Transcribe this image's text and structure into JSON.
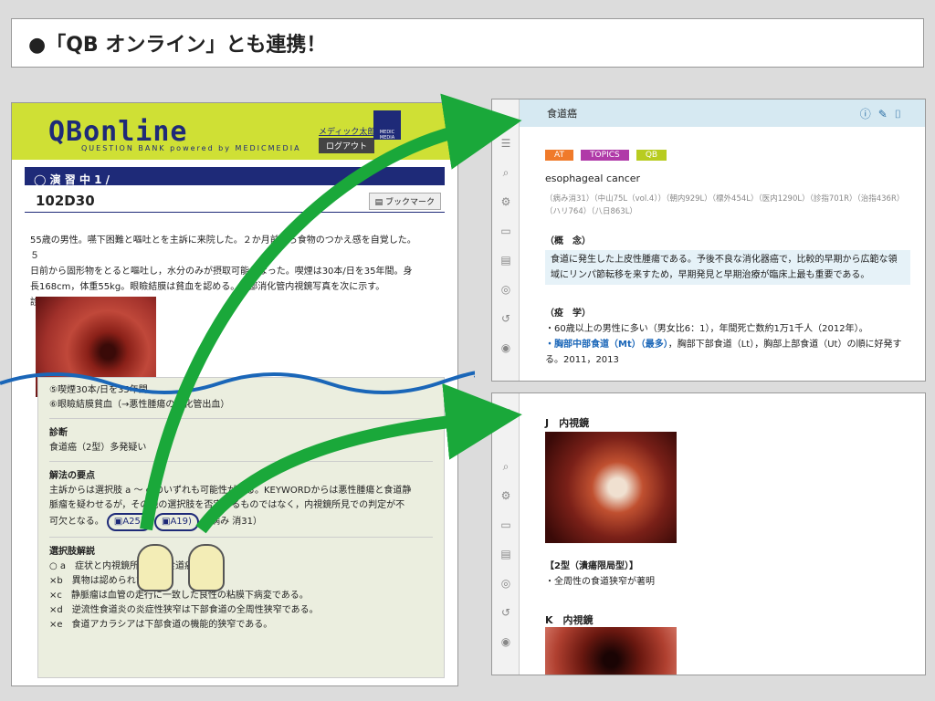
{
  "banner": {
    "title": "●「QB オンライン」とも連携！"
  },
  "qb": {
    "logo": "QBonline",
    "logo_sub": "QUESTION BANK   powered by MEDICMEDIA",
    "user": "メディック太郎",
    "logout": "ログアウト",
    "mm_logo": "MEDIC MEDIA",
    "bar": "◯ 演 習 中  1 /",
    "question_id": "102D30",
    "bookmark": "ブックマーク",
    "question_lines": [
      "55歳の男性。嚥下困難と嘔吐とを主訴に来院した。２か月前から食物のつかえ感を自覚した。５",
      "日前から固形物をとると嘔吐し，水分のみが摂取可能となった。喫煙は30本/日を35年間。身",
      "長168cm，体重55kg。眼瞼結膜は貧血を認める。上部消化管内視鏡写真を次に示す。",
      "診断はどれか。"
    ],
    "lower_top": [
      "⑤喫煙30本/日を35年間",
      "⑥眼瞼結膜貧血（→悪性腫瘍の消化管出血）"
    ],
    "diag_h": "診断",
    "diag": "食道癌（2型）多発疑い",
    "key_h": "解法の要点",
    "key_lines": [
      "主訴からは選択肢 a 〜 e のいずれも可能性がある。KEYWORDからは悪性腫瘍と食道静",
      "脈瘤を疑わせるが，その他の選択肢を否定するものではなく，内視鏡所見での判定が不",
      "可欠となる。"
    ],
    "ref1": "A25)",
    "ref2": "A19)",
    "ref_tail": "（病み 消31）",
    "choice_h": "選択肢解説",
    "choices": [
      "○ a　症状と内視鏡所見から食道癌である。",
      "×b　異物は認められない。",
      "×c　静脈瘤は血管の走行に一致した良性の粘膜下病変である。",
      "×d　逆流性食道炎の炎症性狭窄は下部食道の全周性狭窄である。",
      "×e　食道アカラシアは下部食道の機能的狭窄である。"
    ]
  },
  "right1": {
    "title": "食道癌",
    "tags": [
      {
        "label": "AT",
        "color": "#f07a2a"
      },
      {
        "label": "TOPICS",
        "color": "#b03aa8"
      },
      {
        "label": "QB",
        "color": "#b8cc20"
      }
    ],
    "english": "esophageal cancer",
    "refs": "（病み消31）（中山75L（vol.4））（朝内929L）（標外454L）（医内1290L）（診指701R）（治指436R）（ハリ764）（八日863L）",
    "concept_h": "（概　念）",
    "concept": "食道に発生した上皮性腫瘍である。予後不良な消化器癌で，比較的早期から広範な領域にリンパ節転移を来すため，早期発見と早期治療が臨床上最も重要である。",
    "epi_h": "（疫　学）",
    "epi1": "・60歳以上の男性に多い（男女比6：1），年間死亡数約1万1千人（2012年）。",
    "epi2_blue": "・胸部中部食道（Mt）（最多）",
    "epi2_rest": "，胸部下部食道（Lt），胸部上部食道（Ut）の順に好発する。2011，2013"
  },
  "right2": {
    "j_title": "J　内視鏡",
    "caption": "【2型（潰瘍限局型）】",
    "desc": "・全周性の食道狭窄が著明",
    "k_title": "K　内視鏡"
  },
  "colors": {
    "accent_green": "#1aa83a",
    "navy": "#1e2a78",
    "lime": "#cfe035"
  }
}
